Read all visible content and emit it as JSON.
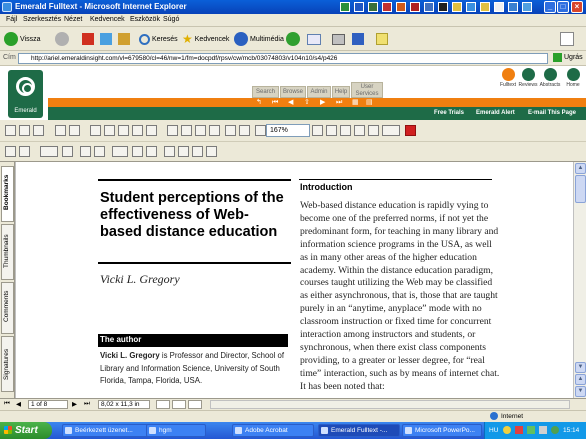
{
  "window": {
    "title": "Emerald Fulltext - Microsoft Internet Explorer",
    "controls": {
      "minimize": "_",
      "maximize": "□",
      "close": "×"
    }
  },
  "menu": [
    "Fájl",
    "Szerkesztés",
    "Nézet",
    "Kedvencek",
    "Eszközök",
    "Súgó"
  ],
  "toolbar": {
    "back": "Vissza",
    "search": "Keresés",
    "favorites": "Kedvencek",
    "media": "Multimédia"
  },
  "address": {
    "label": "Cím",
    "url": "http://ariel.emeraldinsight.com/vl=679580/cl=46/nw=1/fm=docpdf/rpsv/cw/mcb/03074803/v104n10/s4/p426",
    "go": "Ugrás"
  },
  "emerald": {
    "logo_text": "Emerald",
    "tabs": [
      "Search",
      "Browse",
      "Admin",
      "Help",
      "User Services"
    ],
    "links": [
      "Free Trials",
      "Emerald Alert",
      "E-mail This Page"
    ],
    "right_icons": [
      "Fulltext",
      "Reviews",
      "Abstracts",
      "Home"
    ]
  },
  "acrobat": {
    "zoom": "167%",
    "page_indicator": "1 of 8",
    "page_size": "8,02 x 11,3 in",
    "side_tabs": [
      "Bookmarks",
      "Thumbnails",
      "Comments",
      "Signatures"
    ]
  },
  "article": {
    "title": "Student perceptions of the effectiveness of Web-based distance education",
    "author": "Vicki L. Gregory",
    "about_heading": "The author",
    "about_name": "Vicki L. Gregory",
    "about_text": " is Professor and Director, School of Library and Information Science, University of South Florida, Tampa, Florida, USA.",
    "intro_heading": "Introduction",
    "intro_text": "Web-based distance education is rapidly vying to become one of the preferred norms, if not yet the predominant form, for teaching in many library and information science programs in the USA, as well as in many other areas of the higher education academy. Within the distance education paradigm, courses taught utilizing the Web may be classified as either asynchronous, that is, those that are taught purely in an “anytime, anyplace” mode with no classroom instruction or fixed time for concurrent interaction among instructors and students, or synchronous, when there exist class components providing, to a greater or lesser degree, for “real time” interaction, such as by means of internet chat. It has been noted that:"
  },
  "status": {
    "zone": "Internet"
  },
  "taskbar": {
    "start": "Start",
    "tasks": [
      "Beérkezett üzenet...",
      "hgm",
      "Adobe Acrobat",
      "Emerald Fulltext -...",
      "Microsoft PowerPo..."
    ],
    "lang": "HU",
    "clock": "15:14"
  }
}
